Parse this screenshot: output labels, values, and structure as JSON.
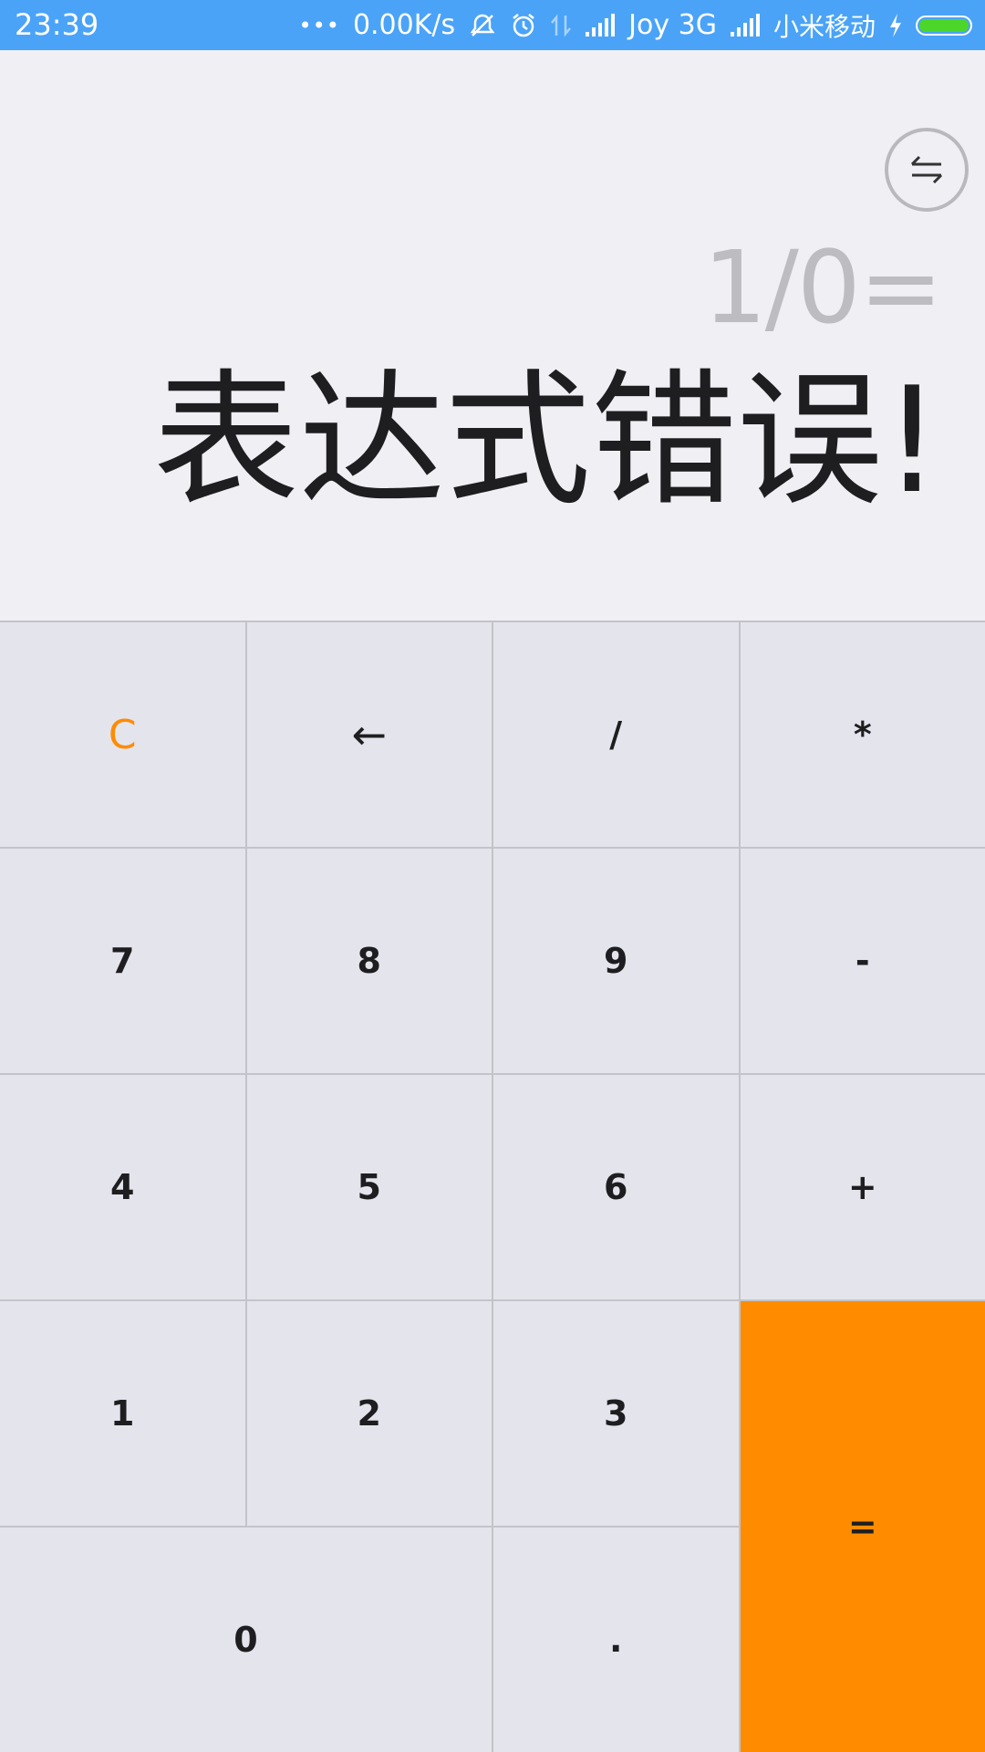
{
  "status_bar": {
    "time": "23:39",
    "more": "•••",
    "speed": "0.00K/s",
    "carrier1": "Joy 3G",
    "carrier2": "小米移动",
    "colors": {
      "background": "#4aa3f7",
      "battery_fill": "#4cd62a"
    },
    "icons": [
      "mute-vibrate-icon",
      "alarm-icon",
      "data-arrows-icon",
      "signal-icon",
      "signal-icon",
      "charging-icon",
      "battery-icon"
    ]
  },
  "display": {
    "switch_icon": "swap-arrows-icon",
    "expression": "1/0=",
    "result": "表达式错误!"
  },
  "keypad": {
    "clear": "C",
    "backspace": "←",
    "divide": "/",
    "multiply": "*",
    "seven": "7",
    "eight": "8",
    "nine": "9",
    "minus": "-",
    "four": "4",
    "five": "5",
    "six": "6",
    "plus": "+",
    "one": "1",
    "two": "2",
    "three": "3",
    "equals": "=",
    "zero": "0",
    "dot": ".",
    "colors": {
      "accent": "#ff8c00",
      "key_bg": "#e4e4ed",
      "divider": "#c3c3c9"
    }
  }
}
